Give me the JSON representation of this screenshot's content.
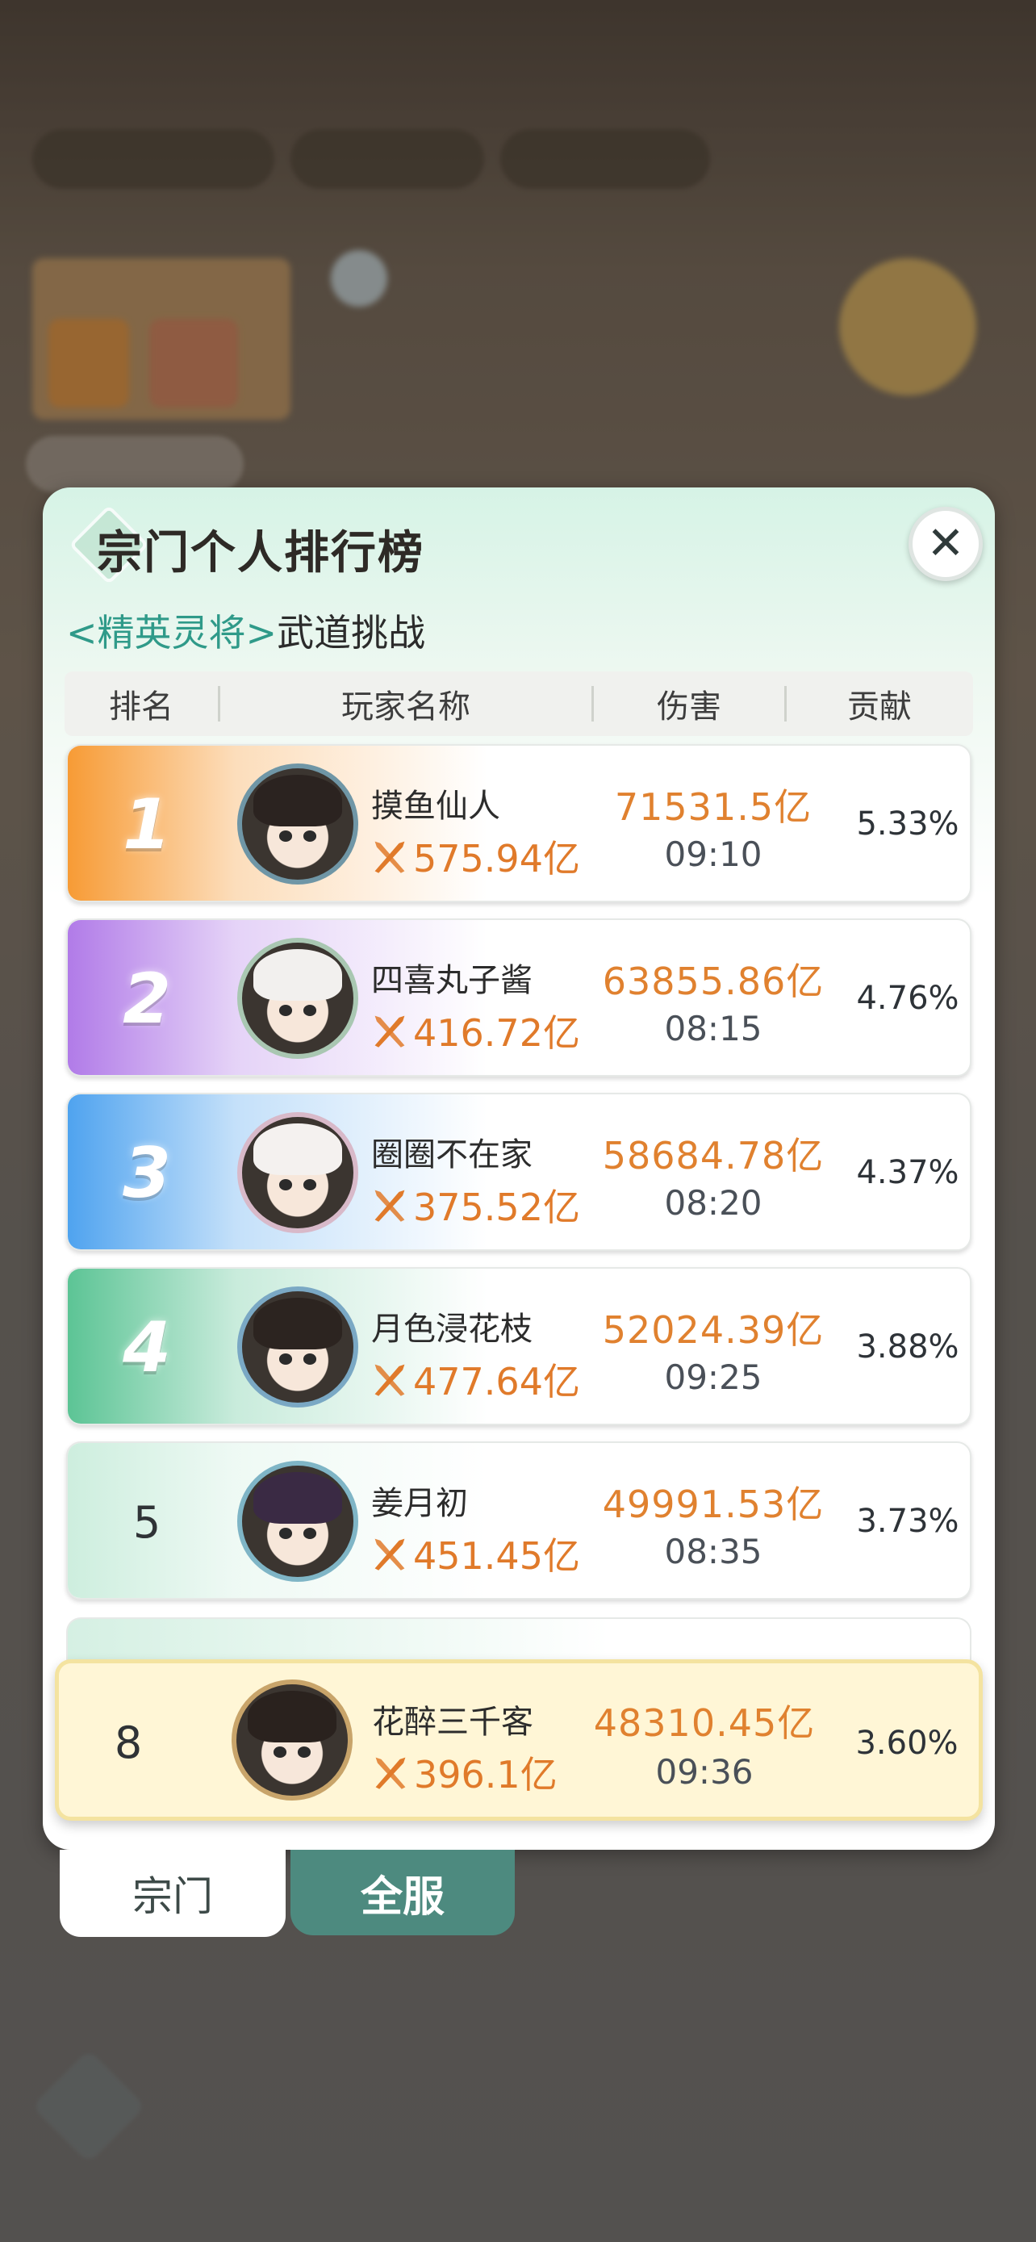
{
  "panel": {
    "title": "宗门个人排行榜",
    "subtitle_tag": "<精英灵将>",
    "subtitle_rest": "武道挑战",
    "close_glyph": "✕"
  },
  "header": {
    "rank": "排名",
    "player": "玩家名称",
    "damage": "伤害",
    "contribution": "贡献"
  },
  "rows": [
    {
      "rank": "1",
      "name": "摸鱼仙人",
      "power": "575.94亿",
      "damage": "71531.5亿",
      "time": "09:10",
      "contribution": "5.33%",
      "badge_color": "#f79b35"
    },
    {
      "rank": "2",
      "name": "四喜丸子酱",
      "power": "416.72亿",
      "damage": "63855.86亿",
      "time": "08:15",
      "contribution": "4.76%",
      "badge_color": "#b17be8"
    },
    {
      "rank": "3",
      "name": "圈圈不在家",
      "power": "375.52亿",
      "damage": "58684.78亿",
      "time": "08:20",
      "contribution": "4.37%",
      "badge_color": "#4fa3ef"
    },
    {
      "rank": "4",
      "name": "月色浸花枝",
      "power": "477.64亿",
      "damage": "52024.39亿",
      "time": "09:25",
      "contribution": "3.88%",
      "badge_color": "#5cc495"
    },
    {
      "rank": "5",
      "name": "姜月初",
      "power": "451.45亿",
      "damage": "49991.53亿",
      "time": "08:35",
      "contribution": "3.73%",
      "badge_color": "#cdeede"
    }
  ],
  "me": {
    "rank": "8",
    "name": "花醉三千客",
    "power": "396.1亿",
    "damage": "48310.45亿",
    "time": "09:36",
    "contribution": "3.60%"
  },
  "tabs": {
    "sect": "宗门",
    "all_server": "全服"
  },
  "colors": {
    "accent_teal": "#4d8a7f",
    "damage_orange": "#e0812f",
    "highlight_row": "#fff6d6"
  }
}
